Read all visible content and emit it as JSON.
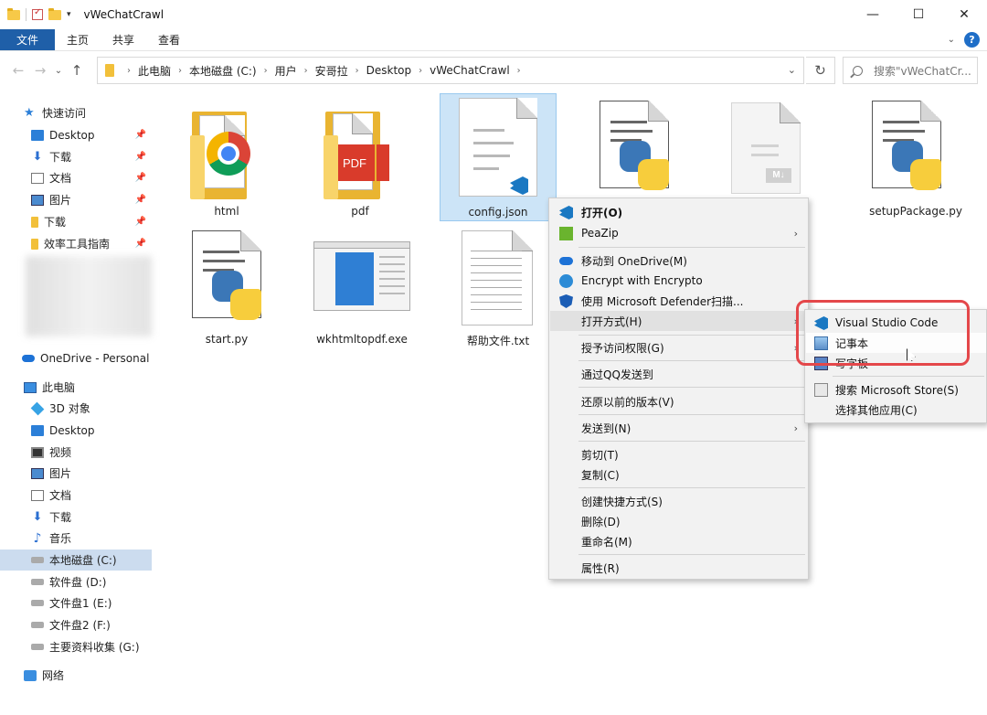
{
  "window": {
    "title": "vWeChatCrawl",
    "minimize": "—",
    "maximize": "☐",
    "close": "✕"
  },
  "ribbon": {
    "tabs": [
      "文件",
      "主页",
      "共享",
      "查看"
    ],
    "help": "?"
  },
  "address": {
    "crumbs": [
      "此电脑",
      "本地磁盘 (C:)",
      "用户",
      "安哥拉",
      "Desktop",
      "vWeChatCrawl"
    ],
    "search_placeholder": "搜索\"vWeChatCr..."
  },
  "sidebar": {
    "quick_access": "快速访问",
    "pinned": [
      "Desktop",
      "下载",
      "文档",
      "图片",
      "下载",
      "效率工具指南"
    ],
    "onedrive": "OneDrive - Personal",
    "this_pc": "此电脑",
    "pc_items": [
      "3D 对象",
      "Desktop",
      "视频",
      "图片",
      "文档",
      "下载",
      "音乐",
      "本地磁盘 (C:)",
      "软件盘 (D:)",
      "文件盘1 (E:)",
      "文件盘2 (F:)",
      "主要资料收集 (G:)"
    ],
    "network": "网络"
  },
  "files": [
    {
      "name": "html",
      "type": "chrome-folder"
    },
    {
      "name": "pdf",
      "type": "pdf-folder"
    },
    {
      "name": "config.json",
      "type": "vscode-doc",
      "selected": true
    },
    {
      "name": "",
      "type": "python"
    },
    {
      "name": "",
      "type": "markdown"
    },
    {
      "name": "setupPackage.py",
      "type": "python"
    },
    {
      "name": "start.py",
      "type": "python"
    },
    {
      "name": "wkhtmltopdf.exe",
      "type": "exe"
    },
    {
      "name": "帮助文件.txt",
      "type": "text"
    }
  ],
  "context_menu": {
    "items": [
      {
        "label": "打开(O)",
        "icon": "vscode-icon",
        "bold": true
      },
      {
        "label": "PeaZip",
        "icon": "peazip-icon",
        "submenu": true
      },
      {
        "label": "移动到 OneDrive(M)",
        "icon": "onedrive-icon"
      },
      {
        "label": "Encrypt with Encrypto",
        "icon": "encrypto-icon"
      },
      {
        "label": "使用 Microsoft Defender扫描...",
        "icon": "defender-icon"
      },
      {
        "label": "打开方式(H)",
        "submenu": true,
        "highlighted": true
      },
      {
        "label": "授予访问权限(G)",
        "submenu": true
      },
      {
        "label": "通过QQ发送到"
      },
      {
        "label": "还原以前的版本(V)"
      },
      {
        "label": "发送到(N)",
        "submenu": true
      },
      {
        "label": "剪切(T)"
      },
      {
        "label": "复制(C)"
      },
      {
        "label": "创建快捷方式(S)"
      },
      {
        "label": "删除(D)"
      },
      {
        "label": "重命名(M)"
      },
      {
        "label": "属性(R)"
      }
    ],
    "submenu_arrow": "›"
  },
  "open_with_menu": {
    "items": [
      {
        "label": "Visual Studio Code",
        "icon": "vscode-icon"
      },
      {
        "label": "记事本",
        "icon": "notepad-icon",
        "highlighted": true
      },
      {
        "label": "写字板",
        "icon": "wordpad-icon"
      },
      {
        "label": "搜索 Microsoft Store(S)",
        "icon": "store-icon"
      },
      {
        "label": "选择其他应用(C)"
      }
    ]
  },
  "colors": {
    "accent": "#1f5fa8",
    "selection": "#cce4f7",
    "highlight_box": "#e4474a"
  }
}
